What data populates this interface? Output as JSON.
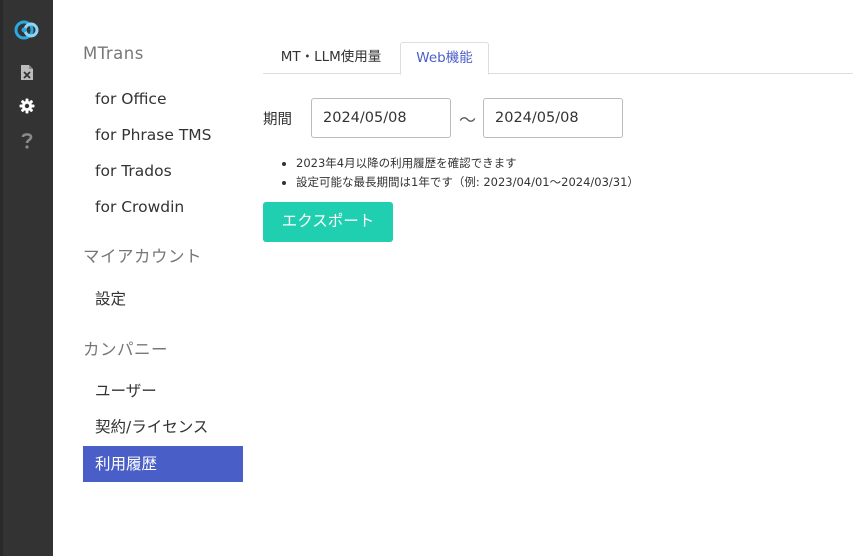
{
  "sidebar": {
    "sections": [
      {
        "title": "MTrans",
        "items": [
          "for Office",
          "for Phrase TMS",
          "for Trados",
          "for Crowdin"
        ]
      },
      {
        "title": "マイアカウント",
        "items": [
          "設定"
        ]
      },
      {
        "title": "カンパニー",
        "items": [
          "ユーザー",
          "契約/ライセンス",
          "利用履歴"
        ]
      }
    ],
    "active_item": "利用履歴",
    "active_color": "#4a5ec8"
  },
  "rail": {
    "icons": [
      "app-logo-icon",
      "excel-file-icon",
      "gear-icon",
      "help-icon"
    ],
    "background": "#333333"
  },
  "tabs": [
    {
      "label": "MT・LLM使用量",
      "active": false
    },
    {
      "label": "Web機能",
      "active": true
    }
  ],
  "filter": {
    "period_label": "期間",
    "from": "2024/05/08",
    "separator": "～",
    "to": "2024/05/08"
  },
  "notes": [
    "2023年4月以降の利用履歴を確認できます",
    "設定可能な最長期間は1年です（例: 2023/04/01～2024/03/31）"
  ],
  "export_button": {
    "label": "エクスポート",
    "color": "#1fcfaf"
  }
}
